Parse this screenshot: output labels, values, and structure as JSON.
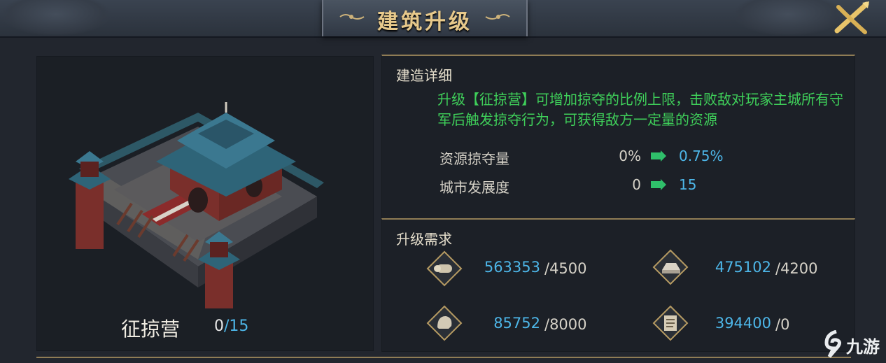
{
  "header": {
    "title": "建筑升级"
  },
  "detail": {
    "section_title": "建造详细",
    "description": "升级【征掠营】可增加掠夺的比例上限，击败敌对玩家主城所有守军后触发掠夺行为，可获得敌方一定量的资源",
    "stats": [
      {
        "label": "资源掠夺量",
        "from": "0%",
        "to": "0.75%"
      },
      {
        "label": "城市发展度",
        "from": "0",
        "to": "15"
      }
    ]
  },
  "requirements": {
    "section_title": "升级需求",
    "items": [
      {
        "icon": "scroll-icon",
        "have": "563353",
        "need": "/4500"
      },
      {
        "icon": "ingot-icon",
        "have": "475102",
        "need": "/4200"
      },
      {
        "icon": "helmet-icon",
        "have": "85752",
        "need": "/8000"
      },
      {
        "icon": "document-icon",
        "have": "394400",
        "need": "/0"
      }
    ]
  },
  "building": {
    "name": "征掠营",
    "level": "0",
    "max_level": "/15"
  },
  "watermark": {
    "text": "九游"
  },
  "colors": {
    "accent_gold": "#e7c98b",
    "green_text": "#3fd05a",
    "blue_value": "#4db6e8"
  }
}
